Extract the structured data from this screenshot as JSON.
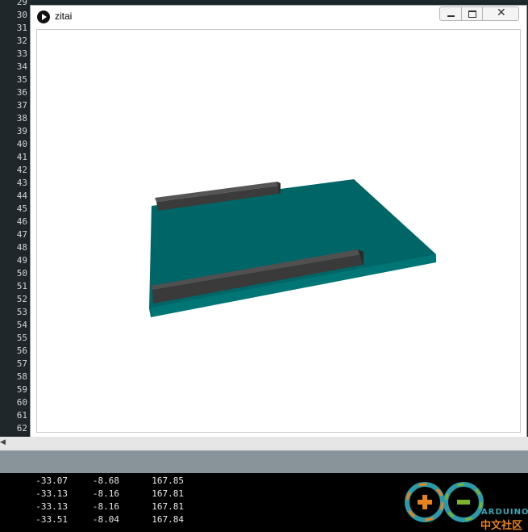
{
  "window": {
    "title": "zitai"
  },
  "gutter": {
    "line_numbers": [
      "29",
      "30",
      "31",
      "32",
      "33",
      "34",
      "35",
      "36",
      "37",
      "38",
      "39",
      "40",
      "41",
      "42",
      "43",
      "44",
      "45",
      "46",
      "47",
      "48",
      "49",
      "50",
      "51",
      "52",
      "53",
      "54",
      "55",
      "56",
      "57",
      "58",
      "59",
      "60",
      "61",
      "62"
    ]
  },
  "console": {
    "rows": [
      [
        "-33.07",
        "-8.68",
        "167.85"
      ],
      [
        "-33.13",
        "-8.16",
        "167.81"
      ],
      [
        "-33.13",
        "-8.16",
        "167.81"
      ],
      [
        "-33.51",
        "-8.04",
        "167.84"
      ]
    ]
  },
  "logo": {
    "text_en": "ARDUINO",
    "text_cn": "中文社区"
  },
  "colors": {
    "board_top": "#006566",
    "board_side": "#007575",
    "header": "#404040"
  }
}
